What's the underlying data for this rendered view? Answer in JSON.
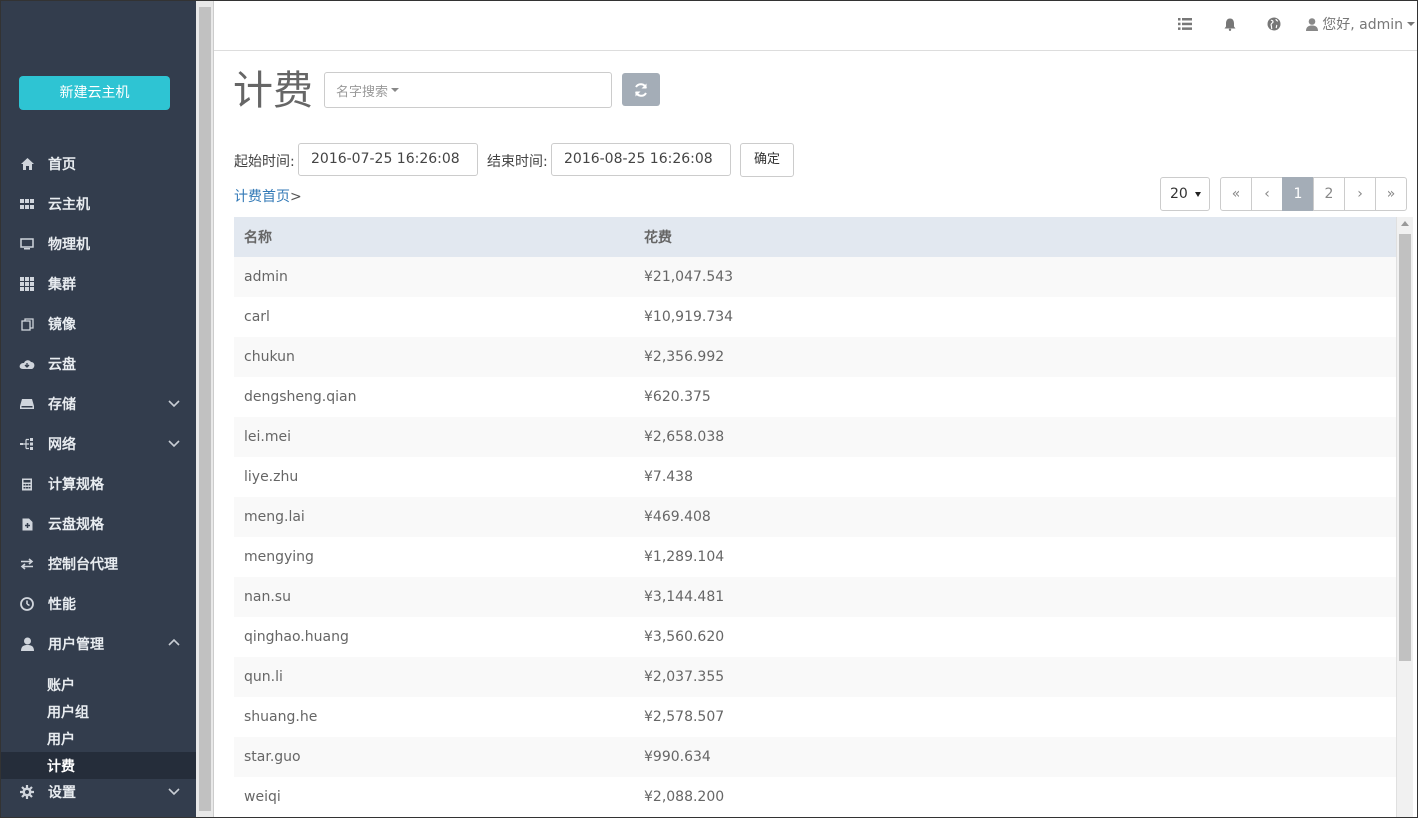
{
  "sidebar": {
    "new_vm_label": "新建云主机",
    "items": [
      {
        "label": "首页",
        "icon": "home-icon"
      },
      {
        "label": "云主机",
        "icon": "grid-small-icon"
      },
      {
        "label": "物理机",
        "icon": "monitor-icon"
      },
      {
        "label": "集群",
        "icon": "grid-icon"
      },
      {
        "label": "镜像",
        "icon": "copy-icon"
      },
      {
        "label": "云盘",
        "icon": "cloud-icon"
      },
      {
        "label": "存储",
        "icon": "hdd-icon"
      },
      {
        "label": "网络",
        "icon": "network-icon"
      },
      {
        "label": "计算规格",
        "icon": "calculator-icon"
      },
      {
        "label": "云盘规格",
        "icon": "file-plus-icon"
      },
      {
        "label": "控制台代理",
        "icon": "transfer-icon"
      },
      {
        "label": "性能",
        "icon": "dashboard-icon"
      },
      {
        "label": "用户管理",
        "icon": "user-icon"
      }
    ],
    "sub_items": [
      {
        "label": "账户"
      },
      {
        "label": "用户组"
      },
      {
        "label": "用户"
      },
      {
        "label": "计费"
      }
    ],
    "settings_label": "设置"
  },
  "topbar": {
    "greeting": "您好, admin"
  },
  "page": {
    "title": "计费",
    "search_placeholder": "名字搜索",
    "start_label": "起始时间:",
    "start_value": "2016-07-25 16:26:08",
    "end_label": "结束时间:",
    "end_value": "2016-08-25 16:26:08",
    "confirm_label": "确定",
    "breadcrumb": "计费首页",
    "breadcrumb_sep": ">",
    "page_size": "20"
  },
  "pagination": [
    "«",
    "‹",
    "1",
    "2",
    "›",
    "»"
  ],
  "table": {
    "headers": [
      "名称",
      "花费"
    ],
    "rows": [
      {
        "name": "admin",
        "cost": "¥21,047.543"
      },
      {
        "name": "carl",
        "cost": "¥10,919.734"
      },
      {
        "name": "chukun",
        "cost": "¥2,356.992"
      },
      {
        "name": "dengsheng.qian",
        "cost": "¥620.375"
      },
      {
        "name": "lei.mei",
        "cost": "¥2,658.038"
      },
      {
        "name": "liye.zhu",
        "cost": "¥7.438"
      },
      {
        "name": "meng.lai",
        "cost": "¥469.408"
      },
      {
        "name": "mengying",
        "cost": "¥1,289.104"
      },
      {
        "name": "nan.su",
        "cost": "¥3,144.481"
      },
      {
        "name": "qinghao.huang",
        "cost": "¥3,560.620"
      },
      {
        "name": "qun.li",
        "cost": "¥2,037.355"
      },
      {
        "name": "shuang.he",
        "cost": "¥2,578.507"
      },
      {
        "name": "star.guo",
        "cost": "¥990.634"
      },
      {
        "name": "weiqi",
        "cost": "¥2,088.200"
      },
      {
        "name": "",
        "cost": ""
      }
    ]
  },
  "colors": {
    "sidebar_bg": "#333d4d",
    "accent": "#2ec4d3",
    "table_header_bg": "#e2e8f0",
    "active_page": "#a4adb7",
    "link": "#337ab7"
  }
}
